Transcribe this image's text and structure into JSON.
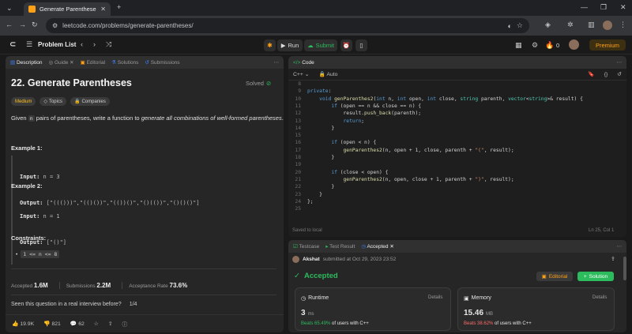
{
  "browser": {
    "tab_title": "Generate Parentheses - LeetCo",
    "url": "leetcode.com/problems/generate-parentheses/"
  },
  "nav": {
    "problem_list": "Problem List",
    "run": "Run",
    "submit": "Submit",
    "streak": "0",
    "premium": "Premium"
  },
  "left": {
    "tabs": [
      "Description",
      "Guide",
      "Editorial",
      "Solutions",
      "Submissions"
    ],
    "title": "22. Generate Parentheses",
    "solved": "Solved",
    "tags": {
      "difficulty": "Medium",
      "topics": "Topics",
      "companies": "Companies"
    },
    "desc": {
      "a": "Given ",
      "n": "n",
      "b": " pairs of parentheses, write a function to ",
      "em": "generate all combinations of well-formed parentheses",
      "c": "."
    },
    "ex1": {
      "title": "Example 1:",
      "input_label": "Input:",
      "input": " n = 3",
      "output_label": "Output:",
      "output": " [\"((()))\",\"(()())\",\"(())()\",\"()(())\",\"()()()\"]"
    },
    "ex2": {
      "title": "Example 2:",
      "input_label": "Input:",
      "input": " n = 1",
      "output_label": "Output:",
      "output": " [\"()\"]"
    },
    "constraints": {
      "title": "Constraints:",
      "item": "1 <= n <= 8"
    },
    "stats": {
      "accepted_label": "Accepted",
      "accepted": "1.6M",
      "submissions_label": "Submissions",
      "submissions": "2.2M",
      "rate_label": "Acceptance Rate",
      "rate": "73.6%"
    },
    "interview": {
      "q": "Seen this question in a real interview before?",
      "page": "1/4"
    },
    "footer": {
      "likes": "19.9K",
      "dislikes": "821",
      "comments": "62"
    }
  },
  "code": {
    "tab": "Code",
    "lang": "C++",
    "auto": "Auto",
    "saved": "Saved to local",
    "pos": "Ln 25, Col 1",
    "lines": [
      {
        "n": "8",
        "t": ""
      },
      {
        "n": "9",
        "t": "private:"
      },
      {
        "n": "10",
        "t": "    void genParenthes2(int n, int open, int close, string parenth, vector<string>& result) {"
      },
      {
        "n": "11",
        "t": "        if (open == n && close == n) {"
      },
      {
        "n": "12",
        "t": "            result.push_back(parenth);"
      },
      {
        "n": "13",
        "t": "            return;"
      },
      {
        "n": "14",
        "t": "        }"
      },
      {
        "n": "15",
        "t": ""
      },
      {
        "n": "16",
        "t": "        if (open < n) {"
      },
      {
        "n": "17",
        "t": "            genParenthes2(n, open + 1, close, parenth + \"(\", result);"
      },
      {
        "n": "18",
        "t": "        }"
      },
      {
        "n": "19",
        "t": ""
      },
      {
        "n": "20",
        "t": "        if (close < open) {"
      },
      {
        "n": "21",
        "t": "            genParenthes2(n, open, close + 1, parenth + \")\", result);"
      },
      {
        "n": "22",
        "t": "        }"
      },
      {
        "n": "23",
        "t": "    }"
      },
      {
        "n": "24",
        "t": "};"
      },
      {
        "n": "25",
        "t": ""
      }
    ]
  },
  "result": {
    "tabs": [
      "Testcase",
      "Test Result",
      "Accepted"
    ],
    "user": "Akshat",
    "submitted": " submitted at Oct 29, 2023 23:52",
    "status": "Accepted",
    "editorial": "Editorial",
    "solution": "Solution",
    "runtime": {
      "label": "Runtime",
      "details": "Details",
      "value": "3",
      "unit": "ms",
      "beats": "Beats 65.49%",
      "suffix": " of users with C++"
    },
    "memory": {
      "label": "Memory",
      "details": "Details",
      "value": "15.46",
      "unit": "MB",
      "beats": "Beats 38.62%",
      "suffix": " of users with C++"
    }
  },
  "colors": {
    "green": "#2cbb5d",
    "orange": "#ffa116",
    "yellow": "#ffc01e",
    "red": "#ff6b6b"
  }
}
